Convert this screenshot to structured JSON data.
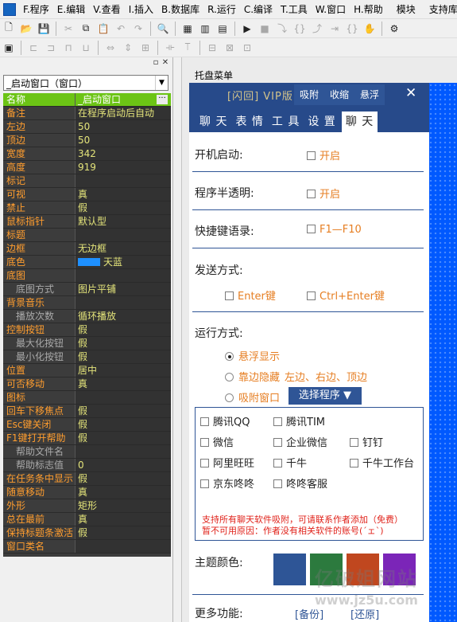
{
  "menubar": {
    "items": [
      "F.程序",
      "E.编辑",
      "V.查看",
      "I.插入",
      "B.数据库",
      "R.运行",
      "C.编译",
      "T.工具",
      "W.窗口",
      "H.帮助"
    ],
    "extra": [
      "模块",
      "支持库"
    ]
  },
  "left_pane": {
    "selector": "_启动窗口（窗口）",
    "selected_color_name": "天蓝",
    "selected_color": "#1e90ff",
    "properties": [
      {
        "key": "名称",
        "value": "_启动窗口",
        "selected": true,
        "dots": true
      },
      {
        "key": "备注",
        "value": "在程序启动后自动"
      },
      {
        "key": "左边",
        "value": "50"
      },
      {
        "key": "顶边",
        "value": "50"
      },
      {
        "key": "宽度",
        "value": "342"
      },
      {
        "key": "高度",
        "value": "919"
      },
      {
        "key": "标记",
        "value": ""
      },
      {
        "key": "可视",
        "value": "真"
      },
      {
        "key": "禁止",
        "value": "假"
      },
      {
        "key": "鼠标指针",
        "value": "默认型"
      },
      {
        "key": "标题",
        "value": ""
      },
      {
        "key": "边框",
        "value": "无边框"
      },
      {
        "key": "底色",
        "value": "天蓝",
        "swatch": true
      },
      {
        "key": "底图",
        "value": ""
      },
      {
        "key": "底图方式",
        "value": "图片平铺",
        "sub": true
      },
      {
        "key": "背景音乐",
        "value": ""
      },
      {
        "key": "播放次数",
        "value": "循环播放",
        "sub": true
      },
      {
        "key": "控制按钮",
        "value": "假"
      },
      {
        "key": "最大化按钮",
        "value": "假",
        "sub": true
      },
      {
        "key": "最小化按钮",
        "value": "假",
        "sub": true
      },
      {
        "key": "位置",
        "value": "居中"
      },
      {
        "key": "可否移动",
        "value": "真"
      },
      {
        "key": "图标",
        "value": ""
      },
      {
        "key": "回车下移焦点",
        "value": "假"
      },
      {
        "key": "Esc键关闭",
        "value": "假"
      },
      {
        "key": "F1键打开帮助",
        "value": "假"
      },
      {
        "key": "帮助文件名",
        "value": "",
        "sub": true
      },
      {
        "key": "帮助标志值",
        "value": "0",
        "sub": true
      },
      {
        "key": "在任务条中显示",
        "value": "假"
      },
      {
        "key": "随意移动",
        "value": "真"
      },
      {
        "key": "外形",
        "value": "矩形"
      },
      {
        "key": "总在最前",
        "value": "真"
      },
      {
        "key": "保持标题条激活",
        "value": "假"
      },
      {
        "key": "窗口类名",
        "value": ""
      }
    ]
  },
  "right_pane": {
    "window_label": "托盘菜单"
  },
  "form": {
    "title": "[闪回] VIP版",
    "header_buttons": [
      "吸附",
      "收缩",
      "悬浮"
    ],
    "tabs": [
      "聊 天",
      "表 情",
      "工 具",
      "设 置",
      "聊 天"
    ],
    "active_tab": 4,
    "startup_label": "开机启动:",
    "startup_opt": "开启",
    "transparent_label": "程序半透明:",
    "transparent_opt": "开启",
    "hotkey_label": "快捷键语录:",
    "hotkey_opt": "F1—F10",
    "send_label": "发送方式:",
    "send_opt1": "Enter键",
    "send_opt2": "Ctrl+Enter键",
    "run_label": "运行方式:",
    "run_opt1": "悬浮显示",
    "run_opt2": "靠边隐藏",
    "run_opt2_detail": "左边、右边、顶边",
    "run_opt3": "吸附窗口",
    "select_button": "选择程序 ▼",
    "apps": [
      "腾讯QQ",
      "腾讯TIM",
      "微信",
      "企业微信",
      "钉钉",
      "阿里旺旺",
      "千牛",
      "千牛工作台",
      "京东咚咚",
      "咚咚客服"
    ],
    "notice1": "支持所有聊天软件吸附，可请联系作者添加（免费）",
    "notice2": "暂不可用原因：作者没有相关软件的账号(´ェ`)",
    "theme_label": "主题颜色:",
    "theme_colors": [
      "#2e5596",
      "#2c7a3e",
      "#c0471f",
      "#7b25b8"
    ],
    "more_label": "更多功能:",
    "backup_btn": "[备份]",
    "restore_btn": "[还原]"
  },
  "watermark": {
    "line1": "亿破姐网站",
    "line2": "www.jz5u.com"
  }
}
